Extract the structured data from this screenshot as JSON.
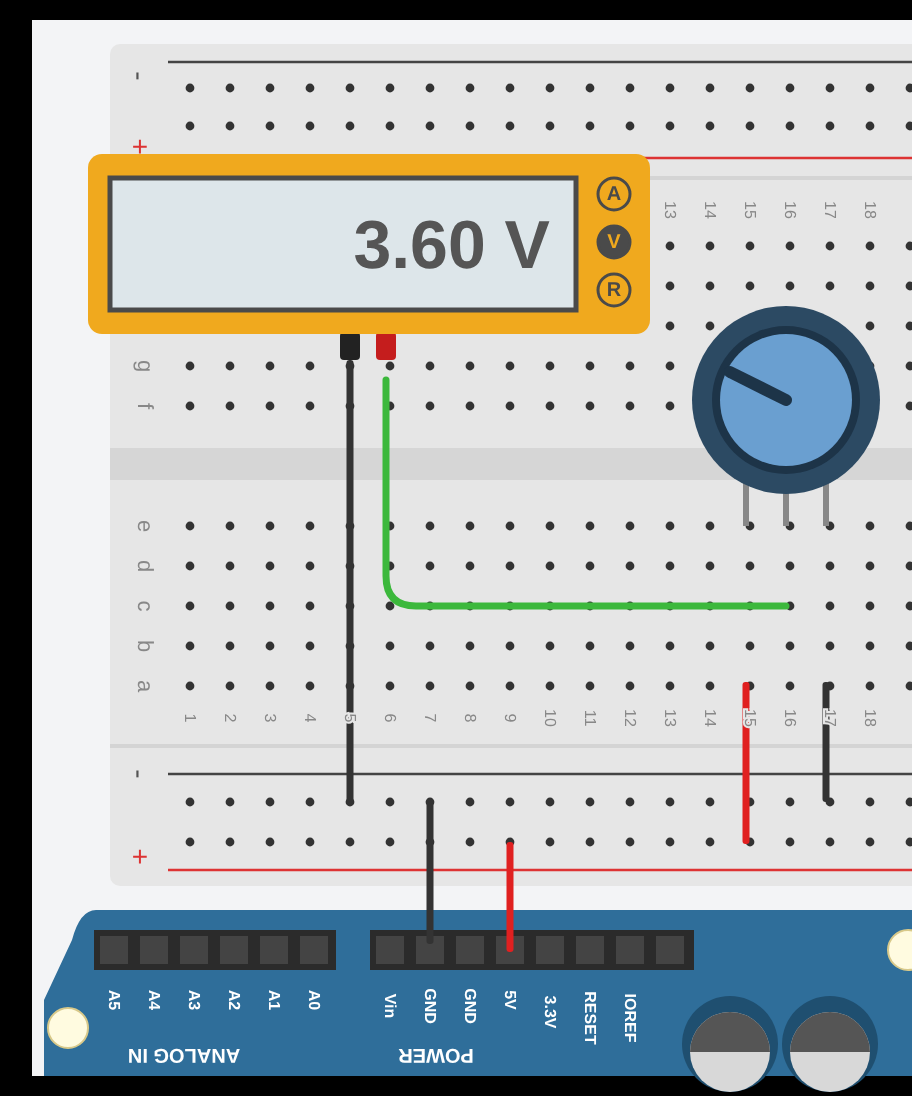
{
  "multimeter": {
    "reading": "3.60 V",
    "modes": [
      {
        "label": "A",
        "selected": false
      },
      {
        "label": "V",
        "selected": true
      },
      {
        "label": "R",
        "selected": false
      }
    ]
  },
  "breadboard": {
    "top_rail_labels": [
      "-",
      "+"
    ],
    "bottom_rail_labels": [
      "-",
      "+"
    ],
    "top_row_labels": [
      "g",
      "f"
    ],
    "bottom_row_labels": [
      "e",
      "d",
      "c",
      "b",
      "a"
    ],
    "top_column_numbers": [
      "13",
      "14",
      "15",
      "16",
      "17",
      "18"
    ],
    "bottom_column_numbers": [
      "1",
      "2",
      "3",
      "4",
      "5",
      "6",
      "7",
      "8",
      "9",
      "10",
      "11",
      "12",
      "13",
      "14",
      "15",
      "16",
      "17",
      "18"
    ]
  },
  "wires": [
    {
      "color": "#333333"
    },
    {
      "color": "#3cb83c"
    },
    {
      "color": "#e02020"
    },
    {
      "color": "#333333"
    },
    {
      "color": "#333333"
    },
    {
      "color": "#e02020"
    }
  ],
  "arduino": {
    "analog_pins": [
      "A5",
      "A4",
      "A3",
      "A2",
      "A1",
      "A0"
    ],
    "analog_title": "ANALOG IN",
    "power_pins": [
      "Vin",
      "GND",
      "GND",
      "5V",
      "3.3V",
      "RESET",
      "IOREF"
    ],
    "power_title": "POWER"
  }
}
